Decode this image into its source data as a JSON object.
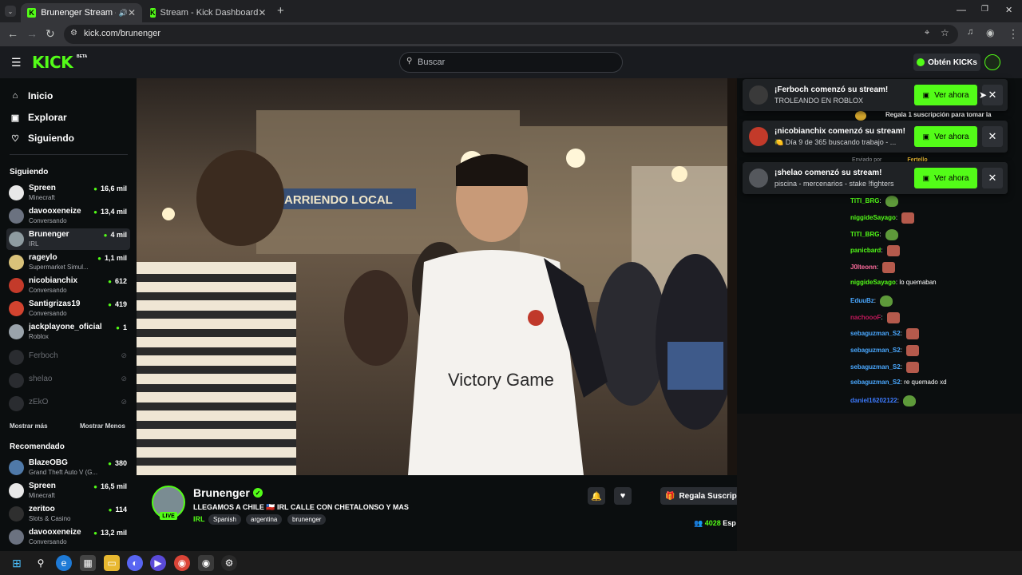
{
  "browser": {
    "tabs": [
      {
        "label": "Brunenger Stream - Watch",
        "active": true
      },
      {
        "label": "Stream - Kick Dashboard",
        "active": false
      }
    ],
    "url": "kick.com/brunenger"
  },
  "header": {
    "logo": "KICK",
    "logo_badge": "BETA",
    "search_placeholder": "Buscar",
    "get_kicks_label": "Obtén KICKs"
  },
  "sidebar": {
    "nav": [
      {
        "label": "Inicio",
        "icon": "home-icon"
      },
      {
        "label": "Explorar",
        "icon": "compass-icon"
      },
      {
        "label": "Siguiendo",
        "icon": "heart-icon"
      }
    ],
    "following_title": "Siguiendo",
    "following": [
      {
        "name": "Spreen",
        "category": "Minecraft",
        "viewers": "16,6 mil"
      },
      {
        "name": "davooxeneize",
        "category": "Conversando",
        "viewers": "13,4 mil"
      },
      {
        "name": "Brunenger",
        "category": "IRL",
        "viewers": "4 mil"
      },
      {
        "name": "rageylo",
        "category": "Supermarket Simul...",
        "viewers": "1,1 mil"
      },
      {
        "name": "nicobianchix",
        "category": "Conversando",
        "viewers": "612"
      },
      {
        "name": "Santigrizas19",
        "category": "Conversando",
        "viewers": "419"
      },
      {
        "name": "jackplayone_oficial",
        "category": "Roblox",
        "viewers": "1"
      }
    ],
    "offline": [
      {
        "name": "Ferboch"
      },
      {
        "name": "shelao"
      },
      {
        "name": "zEkO"
      }
    ],
    "show_more": "Mostrar más",
    "show_less": "Mostrar Menos",
    "recommended_title": "Recomendado",
    "recommended": [
      {
        "name": "BlazeOBG",
        "category": "Grand Theft Auto V (G...",
        "viewers": "380"
      },
      {
        "name": "Spreen",
        "category": "Minecraft",
        "viewers": "16,5 mil"
      },
      {
        "name": "zeritoo",
        "category": "Slots & Casino",
        "viewers": "114"
      },
      {
        "name": "davooxeneize",
        "category": "Conversando",
        "viewers": "13,2 mil"
      }
    ]
  },
  "video": {
    "shirt_text": "Victory Game",
    "sign_text": "ARRIENDO LOCAL"
  },
  "stream": {
    "streamer": "Brunenger",
    "live_label": "LIVE",
    "title": "LLEGAMOS A CHILE 🇨🇱 IRL CALLE CON CHETALONSO Y MAS",
    "category": "IRL",
    "tags": [
      "Spanish",
      "argentina",
      "brunenger"
    ],
    "gift_label": "Regala Suscripcione",
    "viewers": "4028",
    "viewers_suffix": "Esp"
  },
  "chat": {
    "pinned": "Regala 1 suscripción para tomar la",
    "sent_by": "Enviado por",
    "sent_by_user": "Fertello",
    "messages": [
      {
        "user": "TITI_BRG",
        "color": "#53fc18",
        "text": "",
        "emote": "frog"
      },
      {
        "user": "niggideSayago",
        "color": "#53fc18",
        "text": "",
        "emote": "face"
      },
      {
        "user": "TITI_BRG",
        "color": "#53fc18",
        "text": "",
        "emote": "frog"
      },
      {
        "user": "panicbard",
        "color": "#53fc18",
        "text": "",
        "emote": "face"
      },
      {
        "user": "J0lteonn",
        "color": "#ff6b9d",
        "text": "",
        "emote": "face"
      },
      {
        "user": "niggideSayago",
        "color": "#53fc18",
        "text": "lo quemaban",
        "emote": ""
      },
      {
        "user": "EduuBz",
        "color": "#4aa8ff",
        "text": "",
        "emote": "frog"
      },
      {
        "user": "nachoooF",
        "color": "#c2185b",
        "text": "",
        "emote": "face"
      },
      {
        "user": "sebaguzman_S2",
        "color": "#4aa8ff",
        "text": "",
        "emote": "face"
      },
      {
        "user": "sebaguzman_S2",
        "color": "#4aa8ff",
        "text": "",
        "emote": "face"
      },
      {
        "user": "sebaguzman_S2",
        "color": "#4aa8ff",
        "text": "",
        "emote": "face"
      },
      {
        "user": "sebaguzman_S2",
        "color": "#4aa8ff",
        "text": "re quemado xd",
        "emote": ""
      },
      {
        "user": "daniel16202122",
        "color": "#3d7bff",
        "text": "",
        "emote": "frog"
      }
    ]
  },
  "toasts": [
    {
      "title": "¡Ferboch comenzó su stream!",
      "subtitle": "TROLEANDO EN ROBLOX",
      "button": "Ver ahora"
    },
    {
      "title": "¡nicobianchix comenzó su stream!",
      "subtitle": "🍋 Día 9 de 365 buscando trabajo - ...",
      "button": "Ver ahora"
    },
    {
      "title": "¡shelao comenzó su stream!",
      "subtitle": "piscina - mercenarios - stake !fighters",
      "button": "Ver ahora"
    }
  ]
}
